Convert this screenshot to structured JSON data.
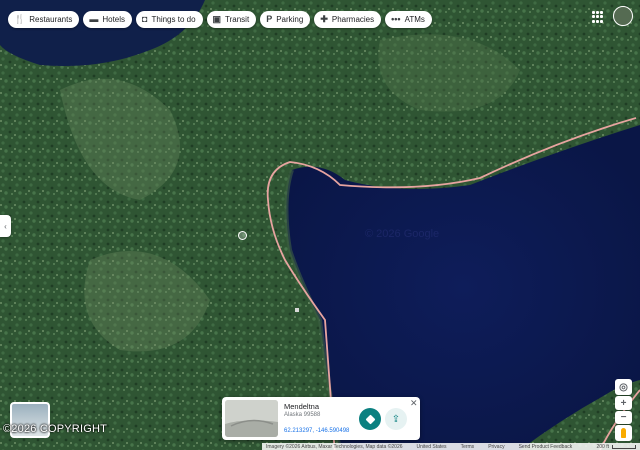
{
  "chips": [
    {
      "icon": "fork-knife-icon",
      "glyph": "🍴",
      "label": "Restaurants"
    },
    {
      "icon": "bed-icon",
      "glyph": "▬",
      "label": "Hotels"
    },
    {
      "icon": "camera-icon",
      "glyph": "◘",
      "label": "Things to do"
    },
    {
      "icon": "bus-icon",
      "glyph": "▣",
      "label": "Transit"
    },
    {
      "icon": "parking-icon",
      "glyph": "P",
      "label": "Parking"
    },
    {
      "icon": "pharmacy-icon",
      "glyph": "✚",
      "label": "Pharmacies"
    },
    {
      "icon": "atm-icon",
      "glyph": "•••",
      "label": "ATMs"
    }
  ],
  "collapse_glyph": "‹",
  "watermark": "© 2026 Google",
  "place_card": {
    "name": "Mendeltna",
    "address": "Alaska 99588",
    "coordinates": "62.213297, -146.590498",
    "close_glyph": "✕",
    "share_glyph": "⇪"
  },
  "copyright": "©2026 COPYRIGHT",
  "controls": {
    "locate": "◎",
    "zoom_in": "+",
    "zoom_out": "−"
  },
  "attribution": {
    "imagery": "Imagery ©2026 Airbus, Maxar Technologies, Map data ©2026",
    "links": [
      "United States",
      "Terms",
      "Privacy",
      "Send Product Feedback"
    ],
    "scale": "200 ft"
  },
  "colors": {
    "road": "#e7a4a0",
    "water": "#0c1a52",
    "forest": "#2c5331",
    "accent": "#0b8080"
  }
}
